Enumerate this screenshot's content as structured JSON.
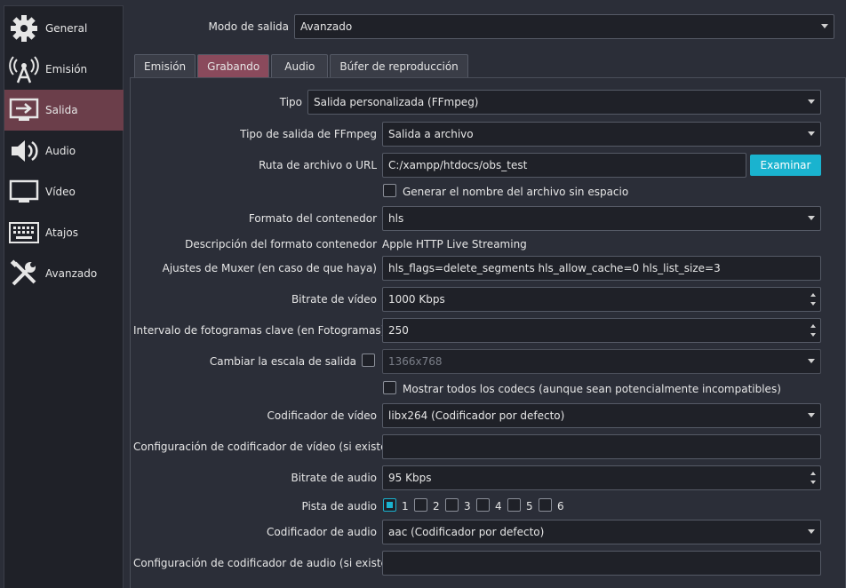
{
  "sidebar": {
    "items": [
      {
        "label": "General",
        "icon": "gear-icon"
      },
      {
        "label": "Emisión",
        "icon": "broadcast-antenna-icon"
      },
      {
        "label": "Salida",
        "icon": "monitor-output-icon"
      },
      {
        "label": "Audio",
        "icon": "speaker-icon"
      },
      {
        "label": "Vídeo",
        "icon": "monitor-icon"
      },
      {
        "label": "Atajos",
        "icon": "keyboard-icon"
      },
      {
        "label": "Avanzado",
        "icon": "tools-icon"
      }
    ],
    "active_index": 2
  },
  "output_mode": {
    "label": "Modo de salida",
    "value": "Avanzado"
  },
  "tabs": [
    {
      "label": "Emisión"
    },
    {
      "label": "Grabando"
    },
    {
      "label": "Audio"
    },
    {
      "label": "Búfer de reproducción"
    }
  ],
  "active_tab": 1,
  "form": {
    "tipo": {
      "label": "Tipo",
      "value": "Salida personalizada (FFmpeg)"
    },
    "ffmpeg_output_type": {
      "label": "Tipo de salida de FFmpeg",
      "value": "Salida a archivo"
    },
    "file_path": {
      "label": "Ruta de archivo o URL",
      "value": "C:/xampp/htdocs/obs_test",
      "browse_label": "Examinar"
    },
    "no_space_filename": {
      "label": "Generar el nombre del archivo sin espacio",
      "checked": false
    },
    "container_format": {
      "label": "Formato del contenedor",
      "value": "hls"
    },
    "container_description": {
      "label": "Descripción del formato contenedor",
      "value": "Apple HTTP Live Streaming"
    },
    "muxer_settings": {
      "label": "Ajustes de Muxer (en caso de que haya)",
      "value": "hls_flags=delete_segments hls_allow_cache=0 hls_list_size=3"
    },
    "video_bitrate": {
      "label": "Bitrate de vídeo",
      "value": "1000 Kbps"
    },
    "keyframe_interval": {
      "label": "Intervalo de fotogramas clave (en Fotogramas)",
      "value": "250"
    },
    "rescale_output": {
      "label": "Cambiar la escala de salida",
      "checked": false,
      "value": "1366x768"
    },
    "show_all_codecs": {
      "label": "Mostrar todos los codecs (aunque sean potencialmente incompatibles)",
      "checked": false
    },
    "video_encoder": {
      "label": "Codificador de vídeo",
      "value": "libx264 (Codificador por defecto)"
    },
    "video_encoder_settings": {
      "label": "Configuración de codificador de vídeo (si existe)",
      "value": ""
    },
    "audio_bitrate": {
      "label": "Bitrate de audio",
      "value": "95 Kbps"
    },
    "audio_track": {
      "label": "Pista de audio",
      "tracks": [
        {
          "label": "1",
          "checked": true
        },
        {
          "label": "2",
          "checked": false
        },
        {
          "label": "3",
          "checked": false
        },
        {
          "label": "4",
          "checked": false
        },
        {
          "label": "5",
          "checked": false
        },
        {
          "label": "6",
          "checked": false
        }
      ]
    },
    "audio_encoder": {
      "label": "Codificador de audio",
      "value": "aac (Codificador por defecto)"
    },
    "audio_encoder_settings": {
      "label": "Configuración de codificador de audio (si existe)",
      "value": ""
    }
  },
  "colors": {
    "accent": "#1ab3cf",
    "active_sidebar": "#6b3e4a",
    "active_tab": "#8a4a5c"
  }
}
